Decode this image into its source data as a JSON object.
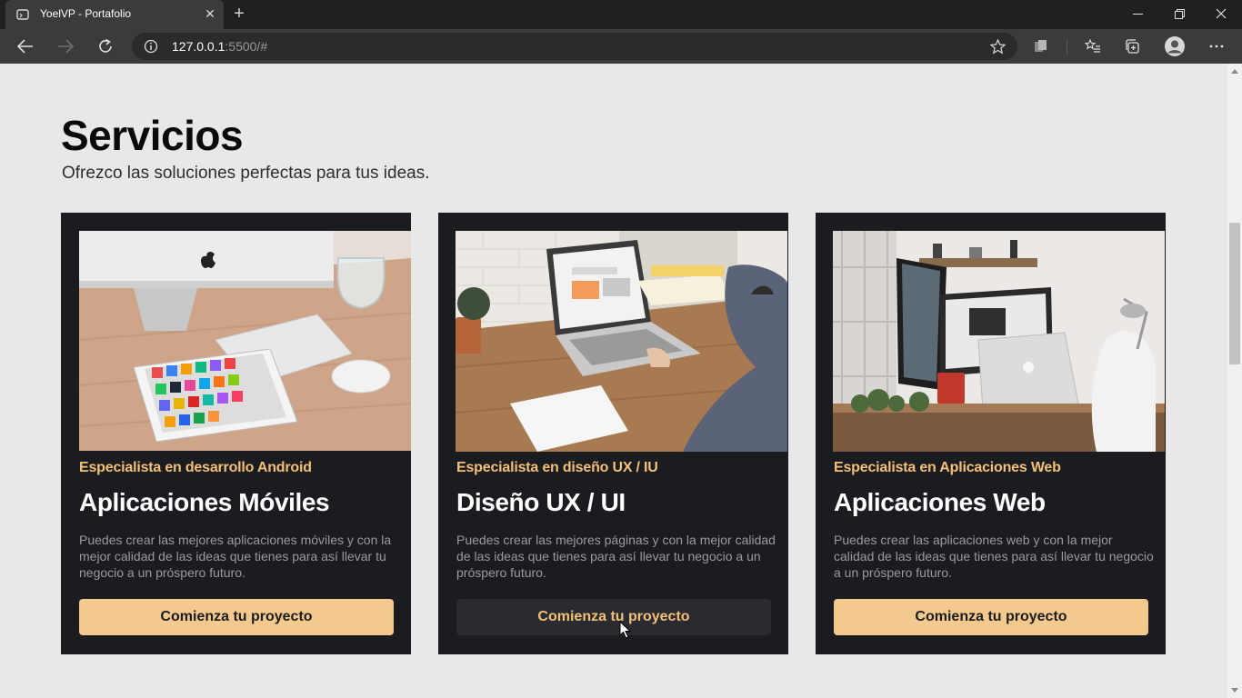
{
  "browser": {
    "tab_title": "YoelVP - Portafolio",
    "url_host": "127.0.0.1",
    "url_path": ":5500/#"
  },
  "section": {
    "title": "Servicios",
    "subtitle": "Ofrezco las soluciones perfectas para tus ideas."
  },
  "cards": [
    {
      "kicker": "Especialista en desarrollo Android",
      "title": "Aplicaciones Móviles",
      "text": "Puedes crear las mejores aplicaciones móviles y con la mejor calidad de las ideas que tienes para así llevar tu negocio a un próspero futuro.",
      "button": "Comienza tu proyecto"
    },
    {
      "kicker": "Especialista en diseño UX / IU",
      "title": "Diseño UX / UI",
      "text": "Puedes crear las mejores páginas y con la mejor calidad de las ideas que tienes para así llevar tu negocio a un próspero futuro.",
      "button": "Comienza tu proyecto"
    },
    {
      "kicker": "Especialista en Aplicaciones Web",
      "title": "Aplicaciones Web",
      "text": "Puedes crear las aplicaciones web y con la mejor calidad de las ideas que tienes para así llevar tu negocio a un próspero futuro.",
      "button": "Comienza tu proyecto"
    }
  ],
  "colors": {
    "page_bg": "#e8e8e8",
    "card_bg": "#1b1c20",
    "accent": "#f4c077",
    "button_bg": "#f4c98e"
  }
}
